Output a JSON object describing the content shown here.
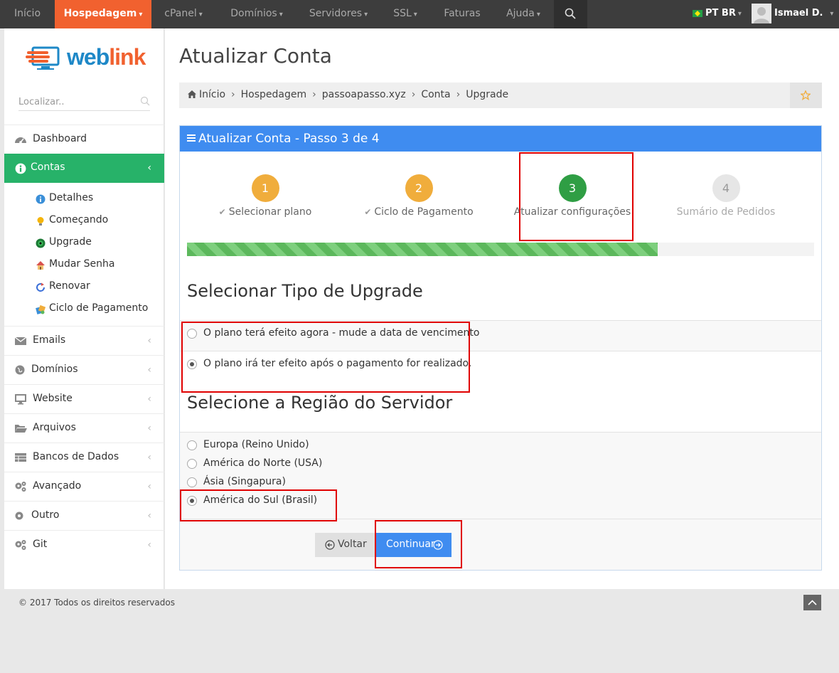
{
  "topnav": {
    "items": [
      {
        "label": "Início"
      },
      {
        "label": "Hospedagem",
        "caret": "▾"
      },
      {
        "label": "cPanel",
        "caret": "▾"
      },
      {
        "label": "Domínios",
        "caret": "▾"
      },
      {
        "label": "Servidores",
        "caret": "▾"
      },
      {
        "label": "SSL",
        "caret": "▾"
      },
      {
        "label": "Faturas"
      },
      {
        "label": "Ajuda",
        "caret": "▾"
      }
    ],
    "language": "PT BR",
    "user": "Ismael D."
  },
  "sidebar": {
    "logo": {
      "part1": "web",
      "part2": "link"
    },
    "search_placeholder": "Localizar..",
    "menu": [
      {
        "label": "Dashboard"
      },
      {
        "label": "Contas",
        "active": true
      },
      {
        "label": "Emails"
      },
      {
        "label": "Domínios"
      },
      {
        "label": "Website"
      },
      {
        "label": "Arquivos"
      },
      {
        "label": "Bancos de Dados"
      },
      {
        "label": "Avançado"
      },
      {
        "label": "Outro"
      },
      {
        "label": "Git"
      }
    ],
    "submenu": [
      {
        "label": "Detalhes"
      },
      {
        "label": "Começando"
      },
      {
        "label": "Upgrade"
      },
      {
        "label": "Mudar Senha"
      },
      {
        "label": "Renovar"
      },
      {
        "label": "Ciclo de Pagamento"
      }
    ]
  },
  "page": {
    "title": "Atualizar Conta",
    "breadcrumb": [
      "Início",
      "Hospedagem",
      "passoapasso.xyz",
      "Conta",
      "Upgrade"
    ]
  },
  "panel": {
    "title": "Atualizar Conta - Passo 3 de 4",
    "steps": [
      {
        "number": "1",
        "label": "Selecionar plano",
        "state": "done"
      },
      {
        "number": "2",
        "label": "Ciclo de Pagamento",
        "state": "done"
      },
      {
        "number": "3",
        "label": "Atualizar configurações",
        "state": "current"
      },
      {
        "number": "4",
        "label": "Sumário de Pedidos",
        "state": "pending"
      }
    ],
    "progress_percent": 75,
    "upgrade_type_title": "Selecionar Tipo de Upgrade",
    "upgrade_options": [
      {
        "label": "O plano terá efeito agora - mude a data de vencimento",
        "checked": false
      },
      {
        "label": "O plano irá ter efeito após o pagamento for realizado.",
        "checked": true
      }
    ],
    "region_title": "Selecione a Região do Servidor",
    "regions": [
      {
        "label": "Europa (Reino Unido)",
        "checked": false
      },
      {
        "label": "América do Norte (USA)",
        "checked": false
      },
      {
        "label": "Ásia (Singapura)",
        "checked": false
      },
      {
        "label": "América do Sul (Brasil)",
        "checked": true
      }
    ],
    "back_label": "Voltar",
    "continue_label": "Continuar"
  },
  "footer": {
    "copyright": "© 2017 Todos os direitos reservados"
  },
  "colors": {
    "nav_bg": "#3d3d3d",
    "nav_active": "#f1612f",
    "sidebar_active": "#27b269",
    "panel_head": "#3f8cf0",
    "step_done": "#f0ad3c",
    "step_current": "#2f9e44",
    "step_pending": "#e6e6e6",
    "highlight_box": "#e00000"
  }
}
